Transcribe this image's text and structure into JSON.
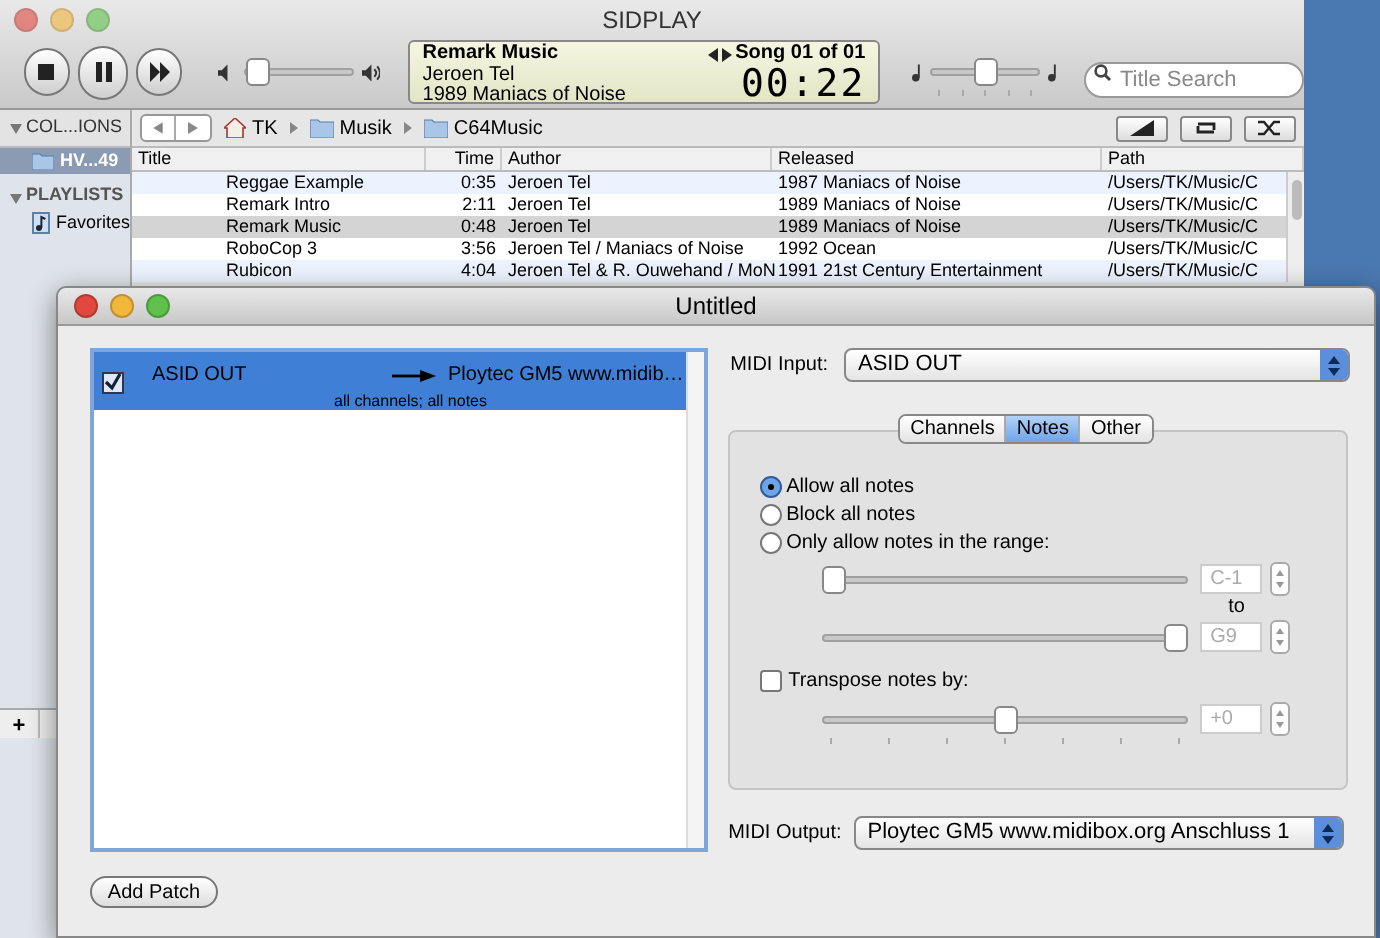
{
  "sidplay": {
    "title": "SIDPLAY",
    "volume": {
      "level": 0.03
    },
    "now_playing": {
      "title": "Remark Music",
      "author": "Jeroen Tel",
      "released": "1989 Maniacs of Noise",
      "song": "Song 01 of 01",
      "time": "00:22"
    },
    "speed": {
      "level": 0.5
    },
    "search": {
      "placeholder": "Title Search"
    },
    "path": [
      "TK",
      "Musik",
      "C64Music"
    ],
    "sidebar": {
      "collections": {
        "label": "COL...IONS",
        "items": [
          {
            "label": "HV...49",
            "selected": true
          }
        ]
      },
      "playlists": {
        "label": "PLAYLISTS",
        "items": [
          {
            "label": "Favorites",
            "selected": false
          }
        ]
      }
    },
    "table": {
      "columns": [
        "Title",
        "Time",
        "Author",
        "Released",
        "Path"
      ],
      "rows": [
        {
          "cells": [
            "Reggae Example",
            "0:35",
            "Jeroen Tel",
            "1987 Maniacs of Noise",
            "/Users/TK/Music/C"
          ],
          "selected": false
        },
        {
          "cells": [
            "Remark Intro",
            "2:11",
            "Jeroen Tel",
            "1989 Maniacs of Noise",
            "/Users/TK/Music/C"
          ],
          "selected": false
        },
        {
          "cells": [
            "Remark Music",
            "0:48",
            "Jeroen Tel",
            "1989 Maniacs of Noise",
            "/Users/TK/Music/C"
          ],
          "selected": true
        },
        {
          "cells": [
            "RoboCop 3",
            "3:56",
            "Jeroen Tel / Maniacs of Noise",
            "1992 Ocean",
            "/Users/TK/Music/C"
          ],
          "selected": false
        },
        {
          "cells": [
            "Rubicon",
            "4:04",
            "Jeroen Tel & R. Ouwehand / MoN",
            "1991 21st Century Entertainment",
            "/Users/TK/Music/C"
          ],
          "selected": false
        }
      ]
    },
    "add_button": "+"
  },
  "patch_window": {
    "title": "Untitled",
    "patches": [
      {
        "checked": true,
        "selected": true,
        "input": "ASID OUT",
        "output": "Ploytec GM5 www.midib…",
        "detail": "all channels; all notes"
      }
    ],
    "add_patch": "Add Patch",
    "midi_input": {
      "label": "MIDI Input:",
      "value": "ASID OUT"
    },
    "tabs": [
      {
        "label": "Channels",
        "selected": false
      },
      {
        "label": "Notes",
        "selected": true
      },
      {
        "label": "Other",
        "selected": false
      }
    ],
    "note_options": [
      {
        "label": "Allow all notes",
        "selected": true
      },
      {
        "label": "Block all notes",
        "selected": false
      },
      {
        "label": "Only allow notes in the range:",
        "selected": false
      }
    ],
    "range": {
      "disabled": true,
      "low": {
        "level": 0,
        "value": "C-1"
      },
      "to": "to",
      "high": {
        "level": 1,
        "value": "G9"
      }
    },
    "transpose": {
      "label": "Transpose notes by:",
      "checked": false,
      "level": 0.5,
      "value": "+0"
    },
    "midi_output": {
      "label": "MIDI Output:",
      "value": "Ploytec GM5 www.midibox.org Anschluss 1"
    }
  }
}
